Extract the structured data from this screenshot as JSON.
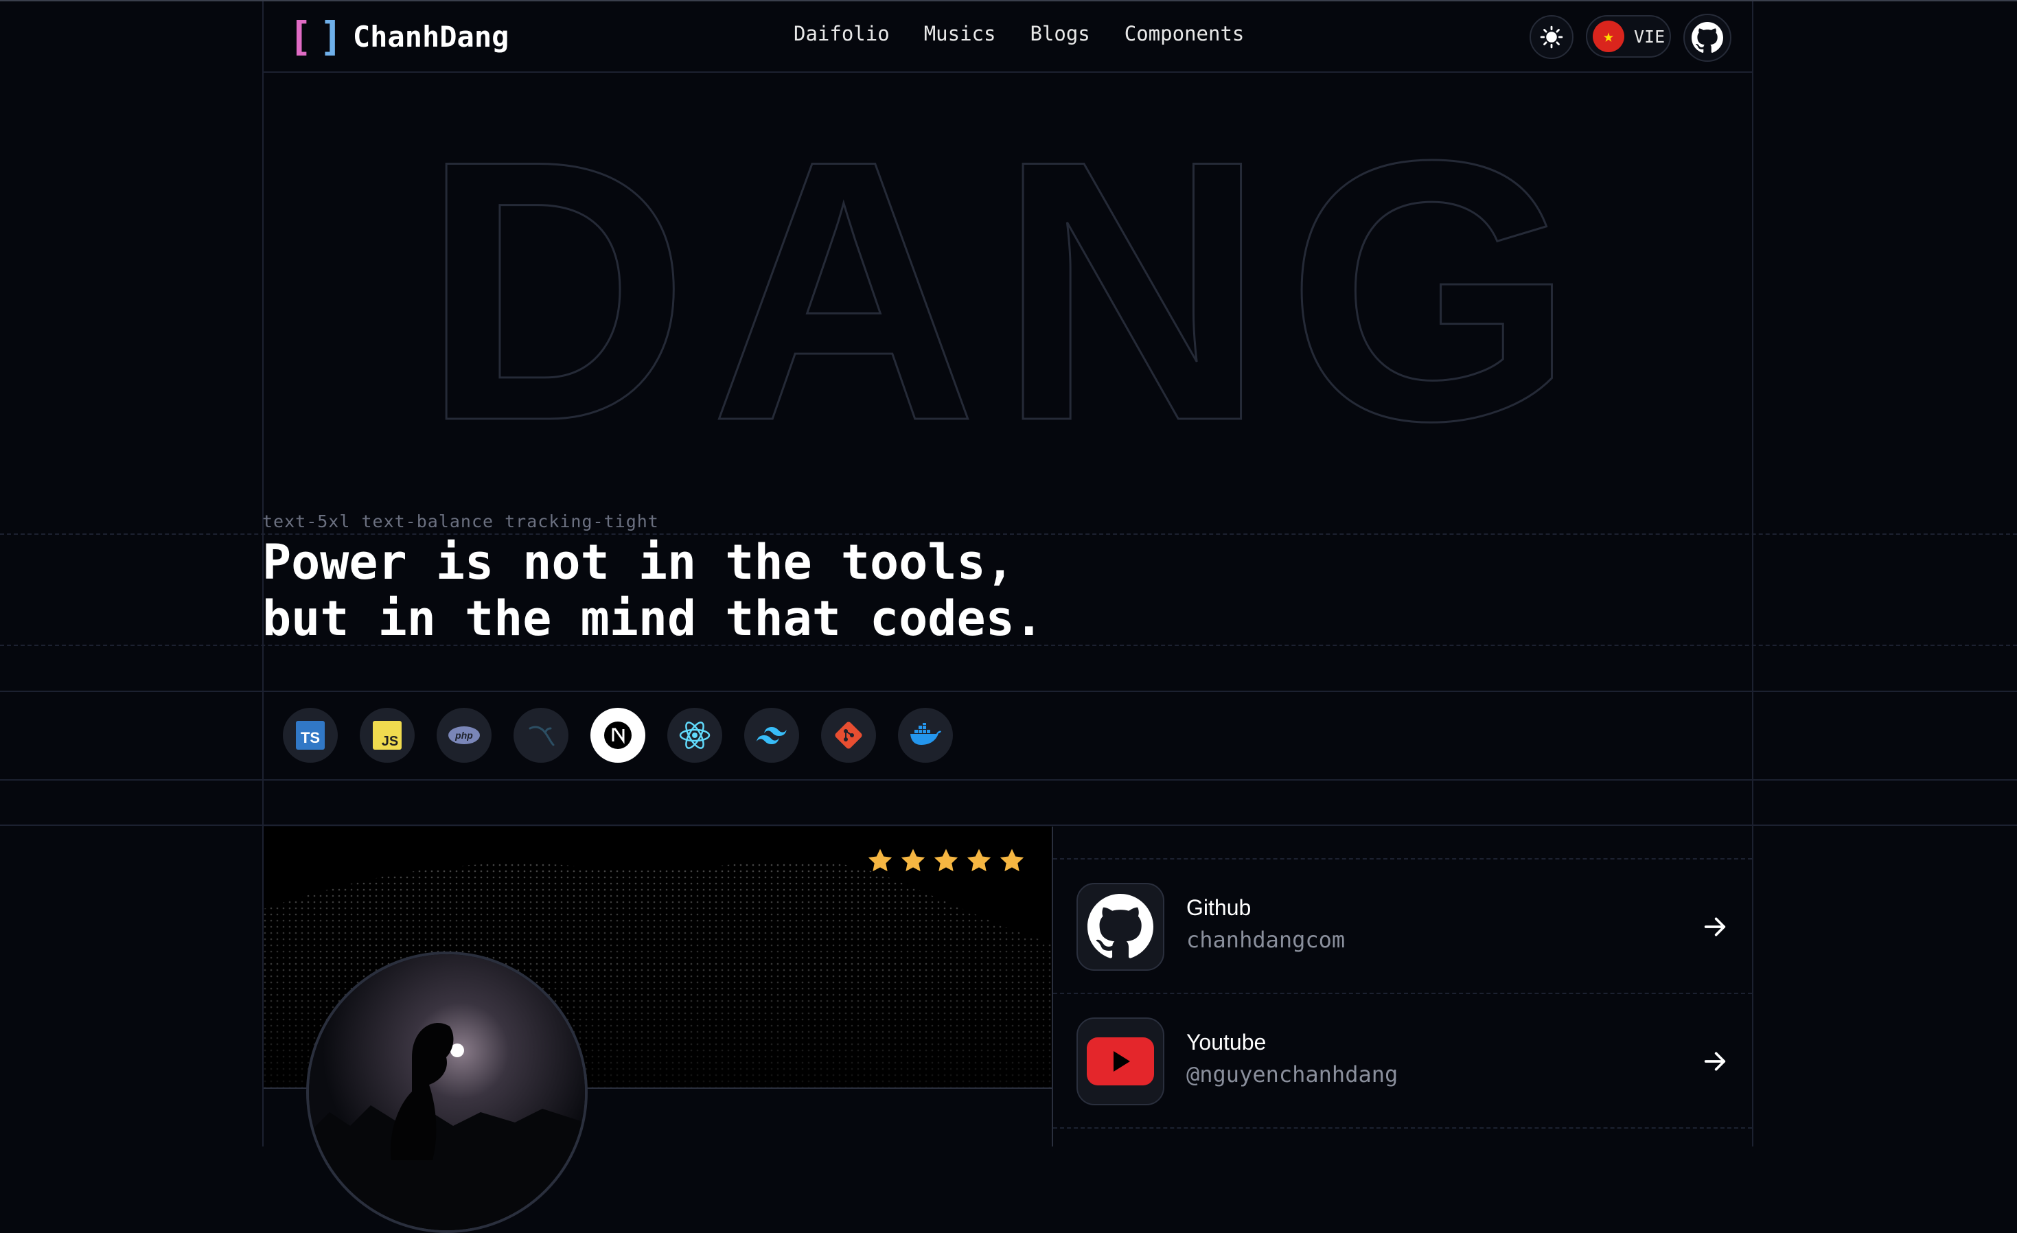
{
  "header": {
    "logo_bracket_left": "[",
    "logo_bracket_right": "]",
    "logo_name": "ChanhDang",
    "nav": [
      "Daifolio",
      "Musics",
      "Blogs",
      "Components"
    ],
    "theme_icon": "sun-icon",
    "language_label": "VIE",
    "language_flag": "vietnam-flag-icon",
    "github_icon": "github-icon"
  },
  "hero": {
    "big_text": "DANG",
    "caption": "text-5xl text-balance tracking-tight",
    "quote_line1": "Power is not in the tools,",
    "quote_line2": "but in the mind that codes."
  },
  "tech_stack": [
    {
      "name": "typescript-icon",
      "label": "TS"
    },
    {
      "name": "javascript-icon",
      "label": "JS"
    },
    {
      "name": "php-icon",
      "label": "php"
    },
    {
      "name": "mysql-icon",
      "label": ""
    },
    {
      "name": "nextjs-icon",
      "label": "N"
    },
    {
      "name": "react-icon",
      "label": ""
    },
    {
      "name": "tailwind-icon",
      "label": ""
    },
    {
      "name": "git-icon",
      "label": ""
    },
    {
      "name": "docker-icon",
      "label": ""
    }
  ],
  "profile": {
    "rating_stars": 5
  },
  "links": [
    {
      "title": "Github",
      "handle": "chanhdangcom",
      "icon": "github-icon"
    },
    {
      "title": "Youtube",
      "handle": "@nguyenchanhdang",
      "icon": "youtube-icon"
    }
  ],
  "colors": {
    "background": "#05070d",
    "grid_line": "#1c2130",
    "star": "#f5b642",
    "youtube_red": "#e4262b",
    "logo_pink": "#e06bc4",
    "logo_blue": "#6fb0ea"
  }
}
